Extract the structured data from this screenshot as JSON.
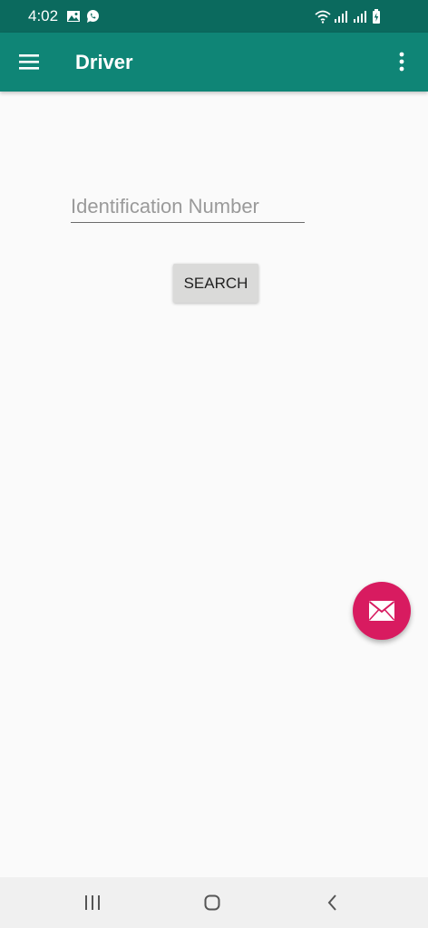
{
  "status_bar": {
    "time": "4:02",
    "left_icons": [
      "image-icon",
      "whatsapp-icon"
    ],
    "right_icons": [
      "wifi-icon",
      "signal-icon",
      "signal-icon",
      "battery-charging-icon"
    ]
  },
  "app_bar": {
    "title": "Driver",
    "menu_icon": "hamburger-menu-icon",
    "overflow_icon": "more-vert-icon"
  },
  "form": {
    "id_placeholder": "Identification Number",
    "id_value": "",
    "search_label": "SEARCH"
  },
  "fab": {
    "icon": "mail-icon"
  },
  "nav_bar": {
    "icons": [
      "recent-apps-icon",
      "home-icon",
      "back-icon"
    ]
  },
  "colors": {
    "status_bar": "#0b6a5e",
    "app_bar": "#0f8576",
    "background": "#fafafa",
    "fab": "#d81b60",
    "button": "#dadad9",
    "nav_bar": "#f0f0f0"
  }
}
